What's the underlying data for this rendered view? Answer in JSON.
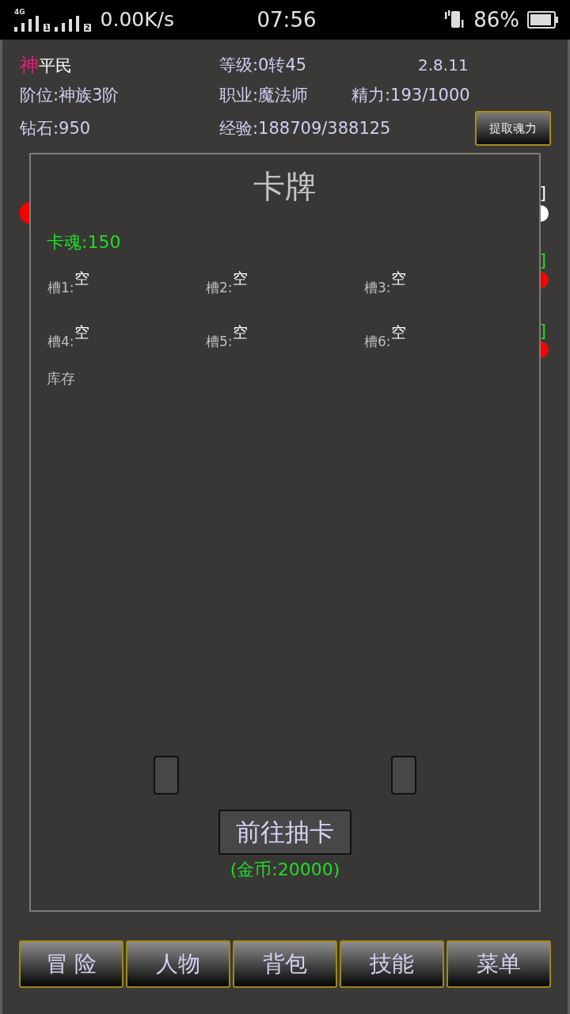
{
  "status_bar": {
    "network": "4G",
    "sims": [
      "1",
      "2"
    ],
    "speed": "0.00K/s",
    "time": "07:56",
    "battery": "86%"
  },
  "profile": {
    "badge": "神",
    "title": "平民",
    "level": "等级:0转45",
    "version": "2.8.11",
    "rank": "阶位:神族3阶",
    "job": "职业:魔法师",
    "energy": "精力:193/1000",
    "diamonds": "钻石:950",
    "exp": "经验:188709/388125",
    "extract_button": "提取魂力"
  },
  "behind_dialog": [
    {
      "right": {
        "kind": "text",
        "text": "]",
        "color": "#ffffff"
      }
    },
    {
      "left": {
        "kind": "dot",
        "color": "#ff0000"
      },
      "right": {
        "kind": "dot",
        "color": "#ffffff"
      }
    },
    {
      "right": {
        "kind": "text",
        "text": "]",
        "color": "#22dd22"
      }
    },
    {
      "right": {
        "kind": "dot",
        "color": "#ff0000"
      }
    },
    {
      "right": {
        "kind": "text",
        "text": "]",
        "color": "#22dd22"
      }
    },
    {
      "right": {
        "kind": "dot",
        "color": "#ff0000"
      }
    }
  ],
  "dialog": {
    "title": "卡牌",
    "card_soul": "卡魂:150",
    "slots": [
      {
        "label": "槽1:",
        "value": "空"
      },
      {
        "label": "槽2:",
        "value": "空"
      },
      {
        "label": "槽3:",
        "value": "空"
      },
      {
        "label": "槽4:",
        "value": "空"
      },
      {
        "label": "槽5:",
        "value": "空"
      },
      {
        "label": "槽6:",
        "value": "空"
      }
    ],
    "inventory_label": "库存",
    "draw_button": "前往抽卡",
    "cost": "(金币:20000)"
  },
  "nav": [
    {
      "label": "冒 险"
    },
    {
      "label": "人物"
    },
    {
      "label": "背包"
    },
    {
      "label": "技能"
    },
    {
      "label": "菜单"
    }
  ]
}
